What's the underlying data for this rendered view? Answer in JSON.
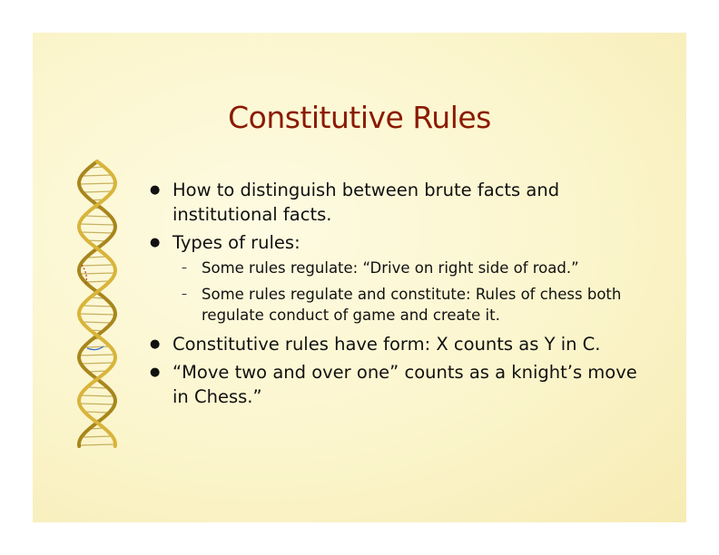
{
  "slide": {
    "title": "Constitutive Rules",
    "bullets": [
      {
        "text": "How to distinguish between brute facts and institutional facts.",
        "sub": []
      },
      {
        "text": "Types of rules:",
        "sub": [
          "Some rules regulate: “Drive on right side of road.”",
          "Some rules regulate and constitute: Rules of chess both regulate conduct of game and create it."
        ]
      },
      {
        "text": "Constitutive rules have form: X counts as Y in C.",
        "sub": []
      },
      {
        "text": "“Move two and over one” counts as a knight’s move in Chess.”",
        "sub": []
      }
    ],
    "bullet_marker": "●",
    "sub_marker": "–"
  },
  "colors": {
    "title": "#8b1a00",
    "background": "#fbf5cc",
    "dna_strand": "#c9a227"
  },
  "icons": {
    "dna": "dna-helix-icon"
  }
}
